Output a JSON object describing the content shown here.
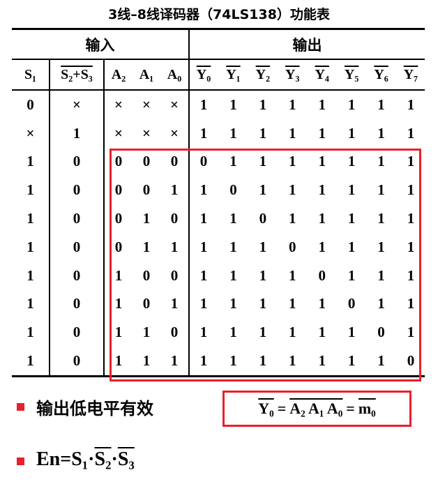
{
  "title": "3线–8线译码器（74LS138）功能表",
  "group_headers": {
    "inputs": "输入",
    "outputs": "输出"
  },
  "column_headers": {
    "s1": "S₁",
    "s23": "S₂+S₃",
    "a": [
      "A₂",
      "A₁",
      "A₀"
    ],
    "y": [
      "Y₀",
      "Y₁",
      "Y₂",
      "Y₃",
      "Y₄",
      "Y₅",
      "Y₆",
      "Y₇"
    ]
  },
  "rows": [
    {
      "s1": "0",
      "s23": "×",
      "a": [
        "×",
        "×",
        "×"
      ],
      "y": [
        "1",
        "1",
        "1",
        "1",
        "1",
        "1",
        "1",
        "1"
      ]
    },
    {
      "s1": "×",
      "s23": "1",
      "a": [
        "×",
        "×",
        "×"
      ],
      "y": [
        "1",
        "1",
        "1",
        "1",
        "1",
        "1",
        "1",
        "1"
      ]
    },
    {
      "s1": "1",
      "s23": "0",
      "a": [
        "0",
        "0",
        "0"
      ],
      "y": [
        "0",
        "1",
        "1",
        "1",
        "1",
        "1",
        "1",
        "1"
      ]
    },
    {
      "s1": "1",
      "s23": "0",
      "a": [
        "0",
        "0",
        "1"
      ],
      "y": [
        "1",
        "0",
        "1",
        "1",
        "1",
        "1",
        "1",
        "1"
      ]
    },
    {
      "s1": "1",
      "s23": "0",
      "a": [
        "0",
        "1",
        "0"
      ],
      "y": [
        "1",
        "1",
        "0",
        "1",
        "1",
        "1",
        "1",
        "1"
      ]
    },
    {
      "s1": "1",
      "s23": "0",
      "a": [
        "0",
        "1",
        "1"
      ],
      "y": [
        "1",
        "1",
        "1",
        "0",
        "1",
        "1",
        "1",
        "1"
      ]
    },
    {
      "s1": "1",
      "s23": "0",
      "a": [
        "1",
        "0",
        "0"
      ],
      "y": [
        "1",
        "1",
        "1",
        "1",
        "0",
        "1",
        "1",
        "1"
      ]
    },
    {
      "s1": "1",
      "s23": "0",
      "a": [
        "1",
        "0",
        "1"
      ],
      "y": [
        "1",
        "1",
        "1",
        "1",
        "1",
        "0",
        "1",
        "1"
      ]
    },
    {
      "s1": "1",
      "s23": "0",
      "a": [
        "1",
        "1",
        "0"
      ],
      "y": [
        "1",
        "1",
        "1",
        "1",
        "1",
        "1",
        "0",
        "1"
      ]
    },
    {
      "s1": "1",
      "s23": "0",
      "a": [
        "1",
        "1",
        "1"
      ],
      "y": [
        "1",
        "1",
        "1",
        "1",
        "1",
        "1",
        "1",
        "0"
      ]
    }
  ],
  "note": "输出低电平有效",
  "formula": {
    "lhs": "Y₀",
    "mid": "A₂ A₁ A₀",
    "rhs": "m₀"
  },
  "enable": {
    "prefix": "En=S₁·",
    "s2": "S₂",
    "dot": "·",
    "s3": "S₃"
  },
  "colors": {
    "highlight": "#e8202c"
  }
}
